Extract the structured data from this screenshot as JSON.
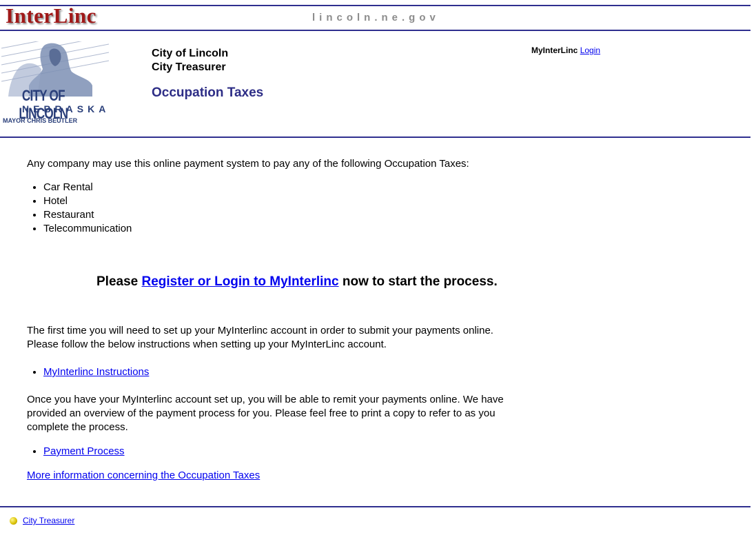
{
  "topbar": {
    "logo": "InterLinc",
    "domain": "lincoln.ne.gov"
  },
  "header": {
    "seal": {
      "line1": "CITY OF LINCOLN",
      "line2": "NEBRASKA",
      "line3": "MAYOR CHRIS BEUTLER"
    },
    "city_line1": "City of Lincoln",
    "city_line2": "City Treasurer",
    "page_title": "Occupation Taxes",
    "myinterlinc_label": "MyInterLinc",
    "login_link": "Login"
  },
  "intro": "Any company may use this online payment system to pay any of the following Occupation Taxes:",
  "tax_types": [
    "Car Rental",
    "Hotel",
    "Restaurant",
    "Telecommunication"
  ],
  "cta": {
    "before": "Please ",
    "link": "Register or Login to MyInterlinc",
    "after": " now to start the process."
  },
  "setup_text_1": "The first time you will need to set up your MyInterlinc account in order to submit your payments online.",
  "setup_text_2": "Please follow the below instructions when setting up your MyInterLinc account.",
  "instructions_link": "MyInterlinc Instructions",
  "overview_text_1": "Once you have your MyInterlinc account set up, you will be able to remit your payments online. We have",
  "overview_text_2": "provided an overview of the payment process for you. Please feel free to print a copy to refer to as you",
  "overview_text_3": "complete the process.",
  "payment_link": "Payment Process",
  "more_info_link": "More information concerning the Occupation Taxes",
  "footer": {
    "link": "City Treasurer",
    "icon": "yellow-ball-icon"
  }
}
